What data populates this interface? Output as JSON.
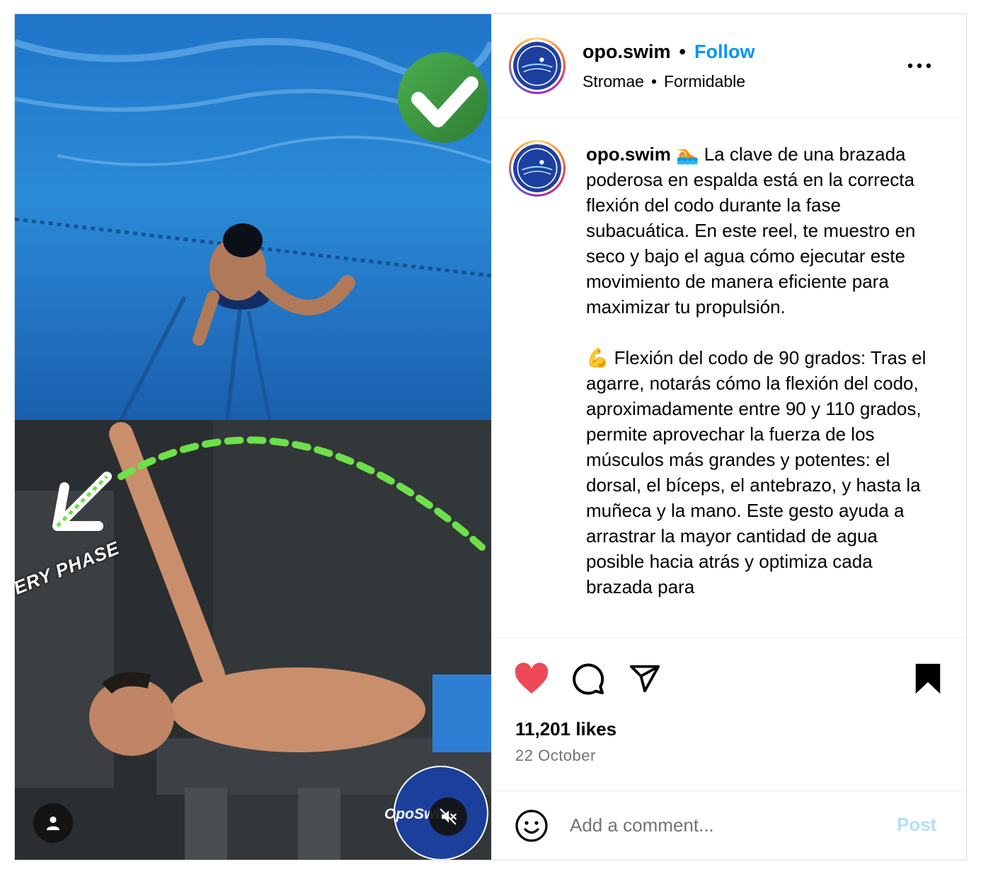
{
  "post": {
    "username": "opo.swim",
    "separator": "•",
    "follow_label": "Follow",
    "audio": {
      "artist": "Stromae",
      "separator": "•",
      "track": "Formidable"
    },
    "more_icon": "more-horizontal-icon"
  },
  "media": {
    "overlay_text": "ERY PHASE",
    "logo_text": "OpoSwim",
    "user_tag_icon": "person-icon",
    "mute_icon": "speaker-muted-icon"
  },
  "caption": {
    "username": "opo.swim",
    "paragraph_1": " 🏊 La clave de una brazada poderosa en espalda está en la correcta flexión del codo durante la fase subacuática. En este reel, te muestro en seco y bajo el agua cómo ejecutar este movimiento de manera eficiente para maximizar tu propulsión.",
    "paragraph_2": "💪 Flexión del codo de 90 grados: Tras el agarre, notarás cómo la flexión del codo, aproximadamente entre 90 y 110 grados, permite aprovechar la fuerza de los músculos más grandes y potentes: el dorsal, el bíceps, el antebrazo, y hasta la muñeca y la mano. Este gesto ayuda a arrastrar la mayor cantidad de agua posible hacia atrás y optimiza cada brazada para"
  },
  "actions": {
    "like_icon": "heart-filled-icon",
    "comment_icon": "comment-icon",
    "share_icon": "share-icon",
    "save_icon": "bookmark-filled-icon",
    "like_color": "#ed4956"
  },
  "stats": {
    "likes": "11,201 likes",
    "date": "22 October"
  },
  "comment_box": {
    "emoji_icon": "emoji-smile-icon",
    "placeholder": "Add a comment...",
    "post_label": "Post",
    "post_color": "#b2dffc"
  },
  "colors": {
    "accent": "#0095f6",
    "muted": "#737373",
    "border": "#dbdbdb"
  }
}
